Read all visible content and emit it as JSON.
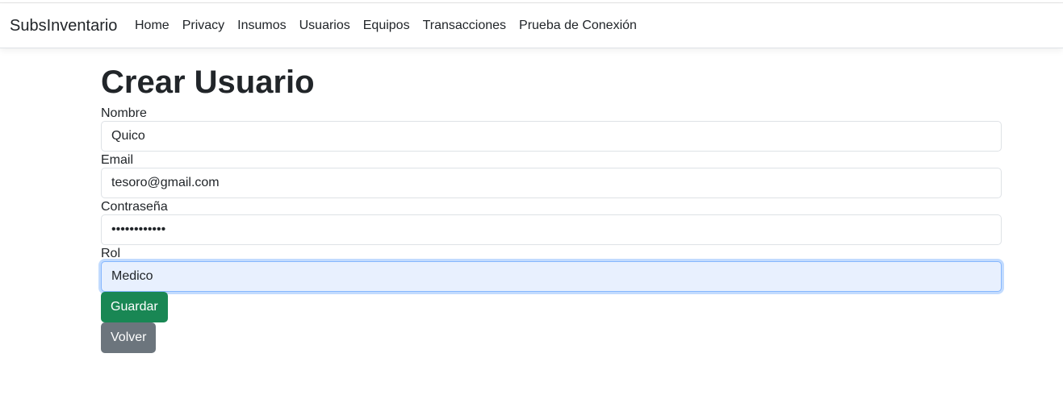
{
  "navbar": {
    "brand": "SubsInventario",
    "links": [
      "Home",
      "Privacy",
      "Insumos",
      "Usuarios",
      "Equipos",
      "Transacciones",
      "Prueba de Conexión"
    ]
  },
  "page": {
    "title": "Crear Usuario"
  },
  "form": {
    "nombre": {
      "label": "Nombre",
      "value": "Quico"
    },
    "email": {
      "label": "Email",
      "value": "tesoro@gmail.com"
    },
    "contrasena": {
      "label": "Contraseña",
      "value": "123456789012"
    },
    "rol": {
      "label": "Rol",
      "value": "Medico"
    }
  },
  "buttons": {
    "save": "Guardar",
    "back": "Volver"
  },
  "colors": {
    "success": "#198754",
    "secondary": "#6c757d",
    "focus_bg": "#e8f0fe"
  }
}
